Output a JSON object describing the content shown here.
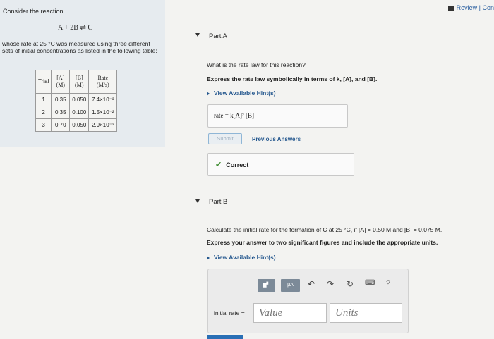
{
  "left": {
    "intro": "Consider the reaction",
    "reaction": "A + 2B ⇌ C",
    "description": "whose rate at 25 °C was measured using three different sets of initial concentrations as listed in the following table:",
    "table": {
      "header_trial": "Trial",
      "header_a": "[A] (M)",
      "header_b": "[B] (M)",
      "header_rate": "Rate (M/s)",
      "rows": [
        {
          "trial": "1",
          "a": "0.35",
          "b": "0.050",
          "rate": "7.4×10⁻³"
        },
        {
          "trial": "2",
          "a": "0.35",
          "b": "0.100",
          "rate": "1.5×10⁻²"
        },
        {
          "trial": "3",
          "a": "0.70",
          "b": "0.050",
          "rate": "2.9×10⁻²"
        }
      ]
    }
  },
  "header": {
    "review_label": "Review | Con"
  },
  "partA": {
    "title": "Part A",
    "question": "What is the rate law for this reaction?",
    "instruction": "Express the rate law symbolically in terms of k, [A], and [B].",
    "hint_label": "View Available Hint(s)",
    "answer": "rate = k[A]² [B]",
    "submit_label": "Submit",
    "previous_label": "Previous Answers",
    "correct_label": "Correct"
  },
  "partB": {
    "title": "Part B",
    "question": "Calculate the initial rate for the formation of C at 25 °C, if [A] = 0.50 M and [B] = 0.075 M.",
    "instruction": "Express your answer to two significant figures and include the appropriate units.",
    "hint_label": "View Available Hint(s)",
    "input_label": "initial rate =",
    "value_placeholder": "Value",
    "units_placeholder": "Units",
    "toolbar": {
      "mu_label": "μA",
      "help_label": "?"
    }
  }
}
